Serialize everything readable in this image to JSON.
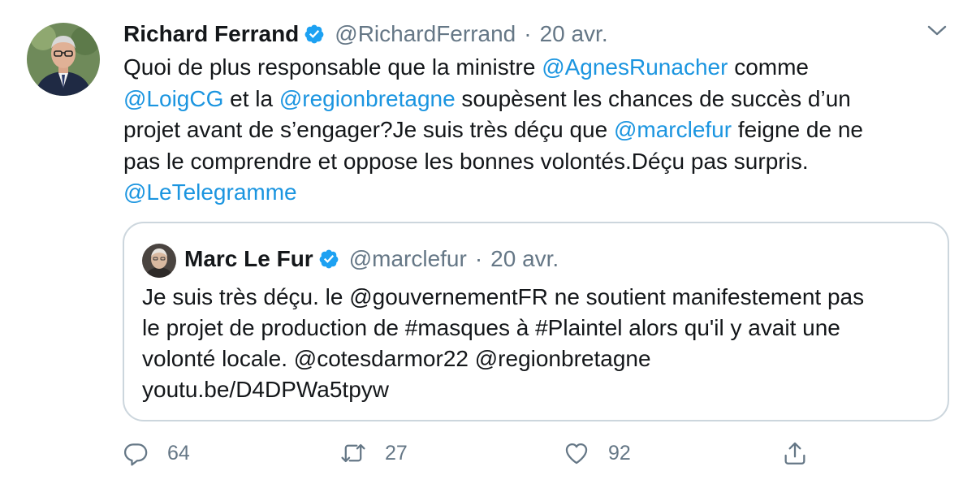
{
  "tweet": {
    "author": {
      "name": "Richard Ferrand",
      "handle": "@RichardFerrand",
      "separator": "·",
      "date": "20 avr."
    },
    "text_lines": [
      [
        {
          "t": "Quoi de plus responsable que la ministre ",
          "m": false
        },
        {
          "t": "@AgnesRunacher",
          "m": true
        },
        {
          "t": " comme",
          "m": false
        }
      ],
      [
        {
          "t": "@LoigCG",
          "m": true
        },
        {
          "t": " et la ",
          "m": false
        },
        {
          "t": "@regionbretagne",
          "m": true
        },
        {
          "t": " soupèsent les chances de succès d’un",
          "m": false
        }
      ],
      [
        {
          "t": "projet avant de s’engager?Je suis très déçu que ",
          "m": false
        },
        {
          "t": "@marclefur",
          "m": true
        },
        {
          "t": " feigne de ne",
          "m": false
        }
      ],
      [
        {
          "t": "pas le comprendre et oppose les bonnes volontés.Déçu pas surpris.",
          "m": false
        }
      ],
      [
        {
          "t": "@LeTelegramme",
          "m": true
        }
      ]
    ],
    "quoted": {
      "author": {
        "name": "Marc Le Fur",
        "handle": "@marclefur",
        "separator": "·",
        "date": "20 avr."
      },
      "text_lines": [
        "Je suis très déçu. le @gouvernementFR ne soutient manifestement pas",
        "le projet de production de #masques à #Plaintel alors qu'il y avait une",
        "volonté locale. @cotesdarmor22 @regionbretagne",
        "youtu.be/D4DPWa5tpyw"
      ]
    },
    "actions": {
      "reply_count": "64",
      "retweet_count": "27",
      "like_count": "92"
    },
    "colors": {
      "mention": "#1b95e0",
      "muted": "#657786",
      "verified": "#1da1f2",
      "border": "#ccd6dd"
    }
  }
}
